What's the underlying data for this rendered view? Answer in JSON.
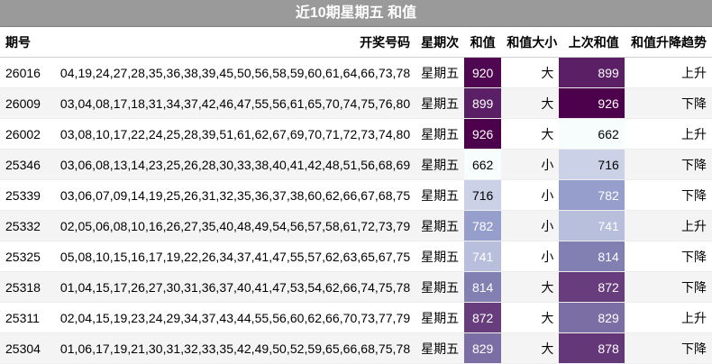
{
  "title": "近10期星期五 和值",
  "headers": {
    "issue": "期号",
    "numbers": "开奖号码",
    "weekday": "星期次",
    "sum": "和值",
    "size": "和值大小",
    "prev_sum": "上次和值",
    "trend": "和值升降趋势"
  },
  "rows": [
    {
      "issue": "26016",
      "numbers": "04,19,24,27,28,35,36,38,39,45,50,56,58,59,60,61,64,66,73,78",
      "weekday": "星期五",
      "sum": "920",
      "size": "大",
      "prev_sum": "899",
      "trend": "上升"
    },
    {
      "issue": "26009",
      "numbers": "03,04,08,17,18,31,34,37,42,46,47,55,56,61,65,70,74,75,76,80",
      "weekday": "星期五",
      "sum": "899",
      "size": "大",
      "prev_sum": "926",
      "trend": "下降"
    },
    {
      "issue": "26002",
      "numbers": "03,08,10,17,22,24,25,28,39,51,61,62,67,69,70,71,72,73,74,80",
      "weekday": "星期五",
      "sum": "926",
      "size": "大",
      "prev_sum": "662",
      "trend": "上升"
    },
    {
      "issue": "25346",
      "numbers": "03,06,08,13,14,23,25,26,28,30,33,38,40,41,42,48,51,56,68,69",
      "weekday": "星期五",
      "sum": "662",
      "size": "小",
      "prev_sum": "716",
      "trend": "下降"
    },
    {
      "issue": "25339",
      "numbers": "03,06,07,09,14,19,25,26,31,32,35,36,37,38,60,62,66,67,68,75",
      "weekday": "星期五",
      "sum": "716",
      "size": "小",
      "prev_sum": "782",
      "trend": "下降"
    },
    {
      "issue": "25332",
      "numbers": "02,05,06,08,10,16,26,27,35,40,48,49,54,56,57,58,61,72,73,79",
      "weekday": "星期五",
      "sum": "782",
      "size": "小",
      "prev_sum": "741",
      "trend": "上升"
    },
    {
      "issue": "25325",
      "numbers": "05,08,10,15,16,17,19,22,26,34,37,41,47,55,57,62,63,65,67,75",
      "weekday": "星期五",
      "sum": "741",
      "size": "小",
      "prev_sum": "814",
      "trend": "下降"
    },
    {
      "issue": "25318",
      "numbers": "01,04,15,17,26,27,30,31,36,37,40,41,47,53,54,62,66,74,75,78",
      "weekday": "星期五",
      "sum": "814",
      "size": "大",
      "prev_sum": "872",
      "trend": "下降"
    },
    {
      "issue": "25311",
      "numbers": "02,04,15,19,23,24,29,34,37,43,44,55,56,60,62,66,70,73,77,79",
      "weekday": "星期五",
      "sum": "872",
      "size": "大",
      "prev_sum": "829",
      "trend": "上升"
    },
    {
      "issue": "25304",
      "numbers": "01,06,17,19,21,30,31,32,33,35,42,49,50,52,59,65,66,68,75,78",
      "weekday": "星期五",
      "sum": "829",
      "size": "大",
      "prev_sum": "878",
      "trend": "下降"
    }
  ],
  "heat_colors": {
    "scale_low": "#f7fcfd",
    "scale_mid": "#8c96c6",
    "scale_high": "#4d004b"
  }
}
